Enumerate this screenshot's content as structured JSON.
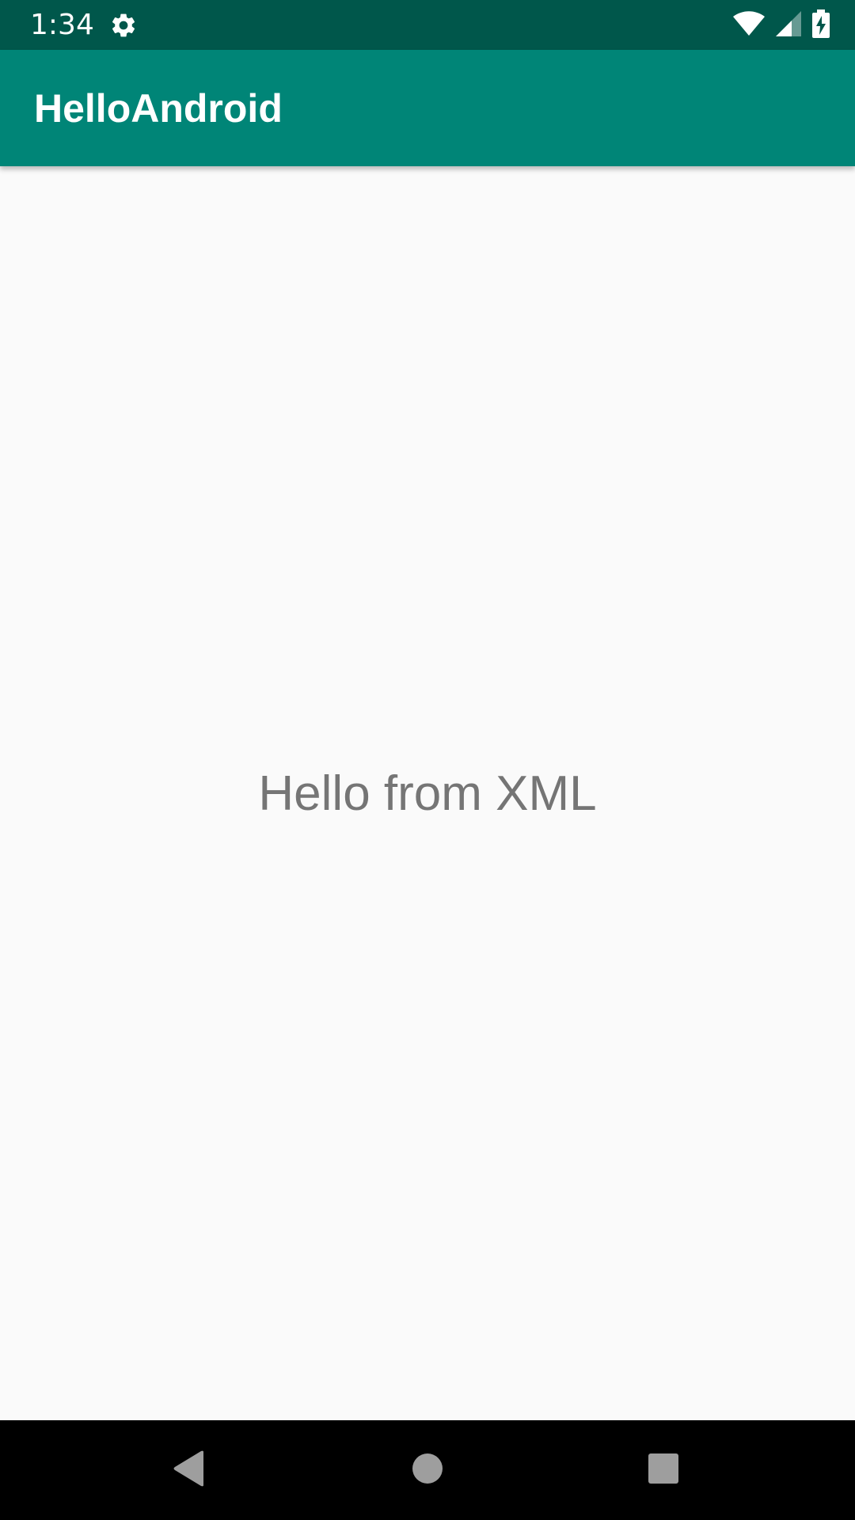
{
  "status_bar": {
    "time": "1:34",
    "icons": [
      "gear-icon",
      "wifi-icon",
      "signal-icon",
      "battery-charging-icon"
    ]
  },
  "app_bar": {
    "title": "HelloAndroid"
  },
  "content": {
    "message": "Hello from XML"
  },
  "nav_bar": {
    "buttons": [
      "back-icon",
      "home-icon",
      "recents-icon"
    ]
  },
  "colors": {
    "status_bar": "#00574b",
    "app_bar": "#008577",
    "background": "#fafafa",
    "text_secondary": "#757575",
    "nav_bar": "#000000"
  }
}
